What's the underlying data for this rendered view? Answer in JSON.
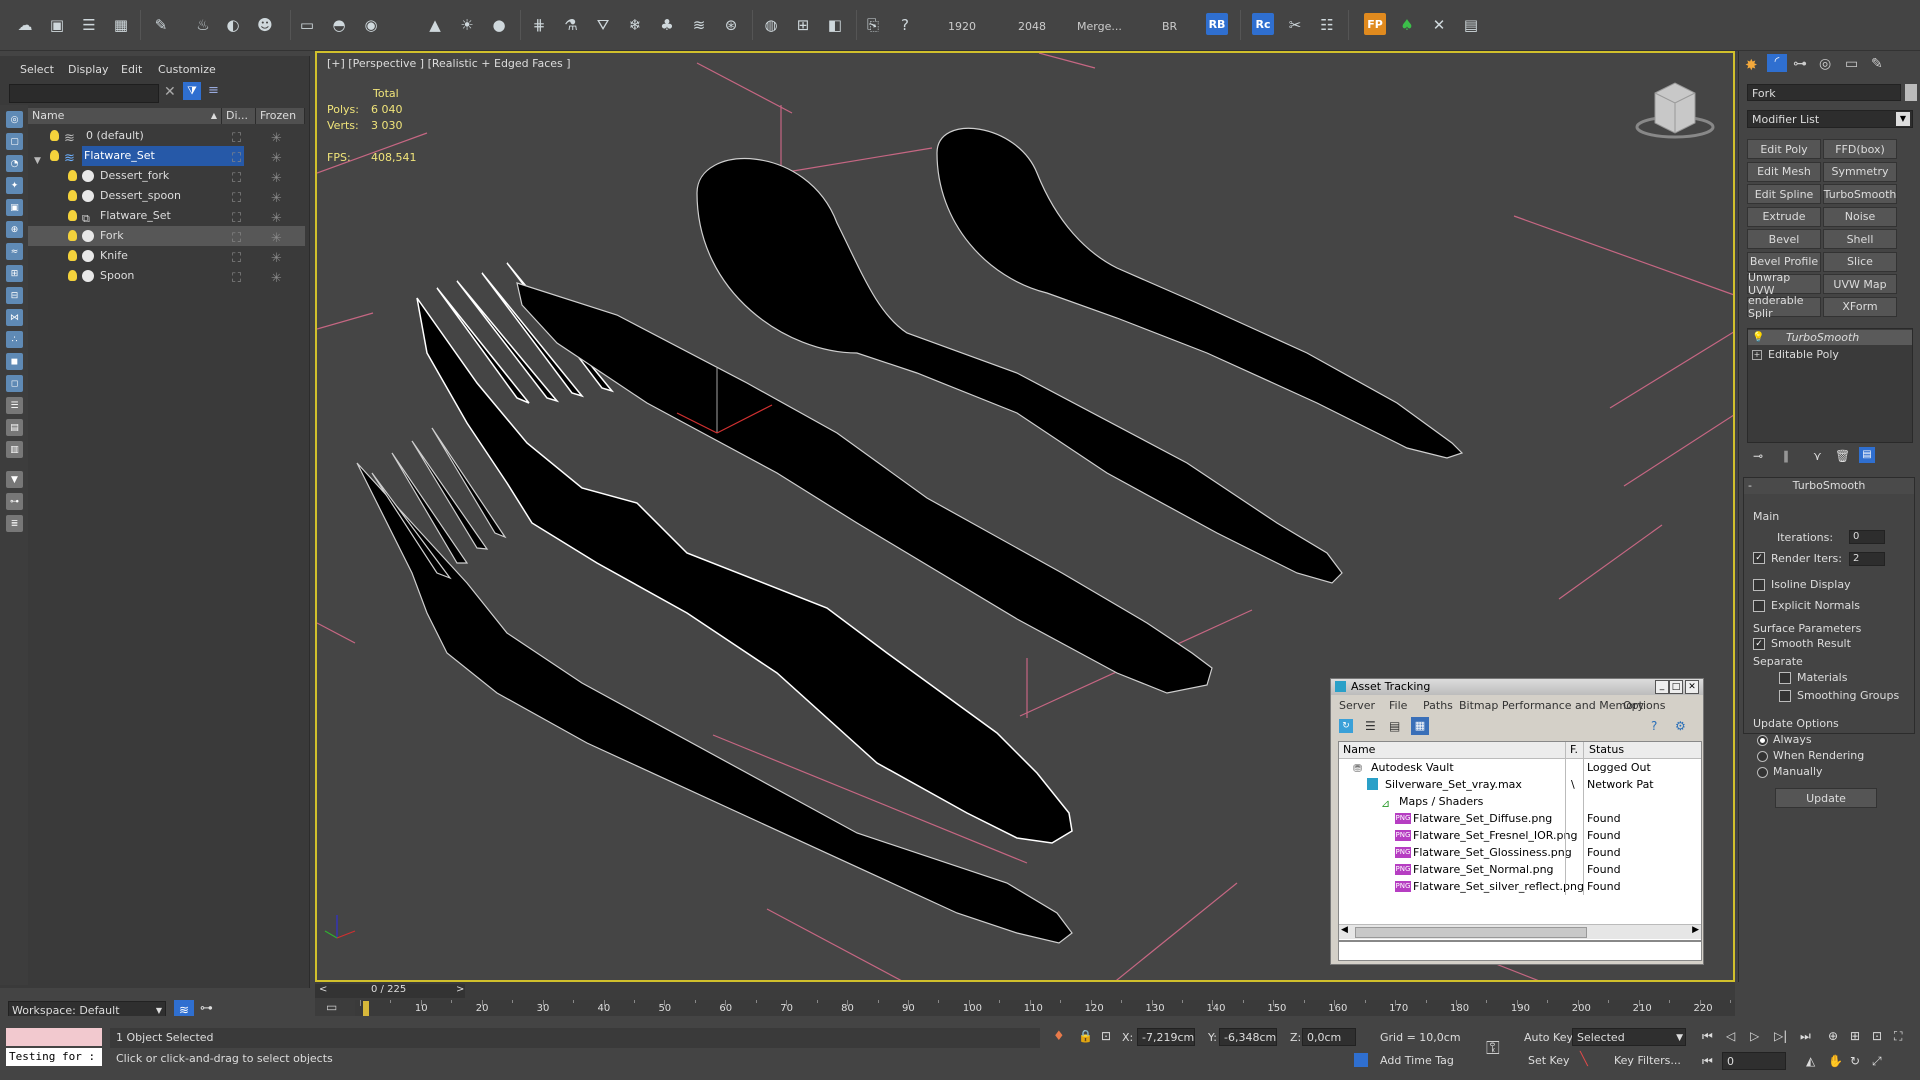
{
  "toolbar": {
    "render_width": "1920",
    "render_height": "2048",
    "merge_label": "Merge...",
    "br_label": "BR",
    "rb_badge": "RB",
    "rc_badge": "Rc",
    "fp_badge": "FP"
  },
  "explorer": {
    "menu": [
      "Select",
      "Display",
      "Edit",
      "Customize"
    ],
    "columns": {
      "name": "Name",
      "display": "Di...",
      "frozen": "Frozen"
    },
    "rows": [
      {
        "label": "0 (default)",
        "depth": 0
      },
      {
        "label": "Flatware_Set",
        "depth": 0
      },
      {
        "label": "Dessert_fork",
        "depth": 1
      },
      {
        "label": "Dessert_spoon",
        "depth": 1
      },
      {
        "label": "Flatware_Set",
        "depth": 1
      },
      {
        "label": "Fork",
        "depth": 1
      },
      {
        "label": "Knife",
        "depth": 1
      },
      {
        "label": "Spoon",
        "depth": 1
      }
    ],
    "workspace": "Workspace: Default"
  },
  "viewport": {
    "label": "[+] [Perspective ] [Realistic + Edged Faces ]",
    "stats": {
      "total_label": "Total",
      "polys_label": "Polys:",
      "polys_value": "6 040",
      "verts_label": "Verts:",
      "verts_value": "3 030",
      "fps_label": "FPS:",
      "fps_value": "408,541"
    }
  },
  "command_panel": {
    "object_name": "Fork",
    "modifier_list": "Modifier List",
    "modifier_buttons": [
      [
        "Edit Poly",
        "FFD(box)"
      ],
      [
        "Edit Mesh",
        "Symmetry"
      ],
      [
        "Edit Spline",
        "TurboSmooth"
      ],
      [
        "Extrude",
        "Noise"
      ],
      [
        "Bevel",
        "Shell"
      ],
      [
        "Bevel Profile",
        "Slice"
      ],
      [
        "Unwrap UVW",
        "UVW Map"
      ],
      [
        "enderable Splir",
        "XForm"
      ]
    ],
    "stack": [
      "TurboSmooth",
      "Editable Poly"
    ],
    "rollout_title": "TurboSmooth",
    "main_label": "Main",
    "iterations_label": "Iterations:",
    "iterations_value": "0",
    "render_iters_label": "Render Iters:",
    "render_iters_value": "2",
    "isoline_label": "Isoline Display",
    "explicit_normals_label": "Explicit Normals",
    "surface_params_label": "Surface Parameters",
    "smooth_result_label": "Smooth Result",
    "separate_label": "Separate",
    "materials_label": "Materials",
    "smoothing_groups_label": "Smoothing Groups",
    "update_options_label": "Update Options",
    "always_label": "Always",
    "when_rendering_label": "When Rendering",
    "manually_label": "Manually",
    "update_button": "Update"
  },
  "asset_tracking": {
    "title": "Asset Tracking",
    "menu": [
      "Server",
      "File",
      "Paths",
      "Bitmap Performance and Memory",
      "Options"
    ],
    "columns": {
      "name": "Name",
      "f": "F.",
      "status": "Status"
    },
    "rows": [
      {
        "name": "Autodesk Vault",
        "f": "",
        "status": "Logged Out",
        "indent": 0,
        "kind": "vault"
      },
      {
        "name": "Silverware_Set_vray.max",
        "f": "\\",
        "status": "Network Pat",
        "indent": 1,
        "kind": "max"
      },
      {
        "name": "Maps / Shaders",
        "f": "",
        "status": "",
        "indent": 2,
        "kind": "maps"
      },
      {
        "name": "Flatware_Set_Diffuse.png",
        "f": "",
        "status": "Found",
        "indent": 3,
        "kind": "png"
      },
      {
        "name": "Flatware_Set_Fresnel_IOR.png",
        "f": "",
        "status": "Found",
        "indent": 3,
        "kind": "png"
      },
      {
        "name": "Flatware_Set_Glossiness.png",
        "f": "",
        "status": "Found",
        "indent": 3,
        "kind": "png"
      },
      {
        "name": "Flatware_Set_Normal.png",
        "f": "",
        "status": "Found",
        "indent": 3,
        "kind": "png"
      },
      {
        "name": "Flatware_Set_silver_reflect.png",
        "f": "",
        "status": "Found",
        "indent": 3,
        "kind": "png"
      }
    ]
  },
  "timeline": {
    "frame_counter": "0 / 225",
    "ticks": [
      "10",
      "20",
      "30",
      "40",
      "50",
      "60",
      "70",
      "80",
      "90",
      "100",
      "110",
      "120",
      "130",
      "140",
      "150",
      "160",
      "170",
      "180",
      "190",
      "200",
      "210",
      "220"
    ]
  },
  "status": {
    "script_text": "Testing for :",
    "selection": "1 Object Selected",
    "prompt": "Click or click-and-drag to select objects",
    "x_label": "X:",
    "x_value": "-7,219cm",
    "y_label": "Y:",
    "y_value": "-6,348cm",
    "z_label": "Z:",
    "z_value": "0,0cm",
    "grid": "Grid = 10,0cm",
    "add_time_tag": "Add Time Tag",
    "auto_key": "Auto Key",
    "set_key": "Set Key",
    "selected_option": "Selected",
    "key_filters": "Key Filters...",
    "frame_value": "0"
  },
  "colors": {
    "selection_blue": "#2659a8",
    "viewport_border": "#d1c02c",
    "stats_yellow": "#f0e47a"
  }
}
